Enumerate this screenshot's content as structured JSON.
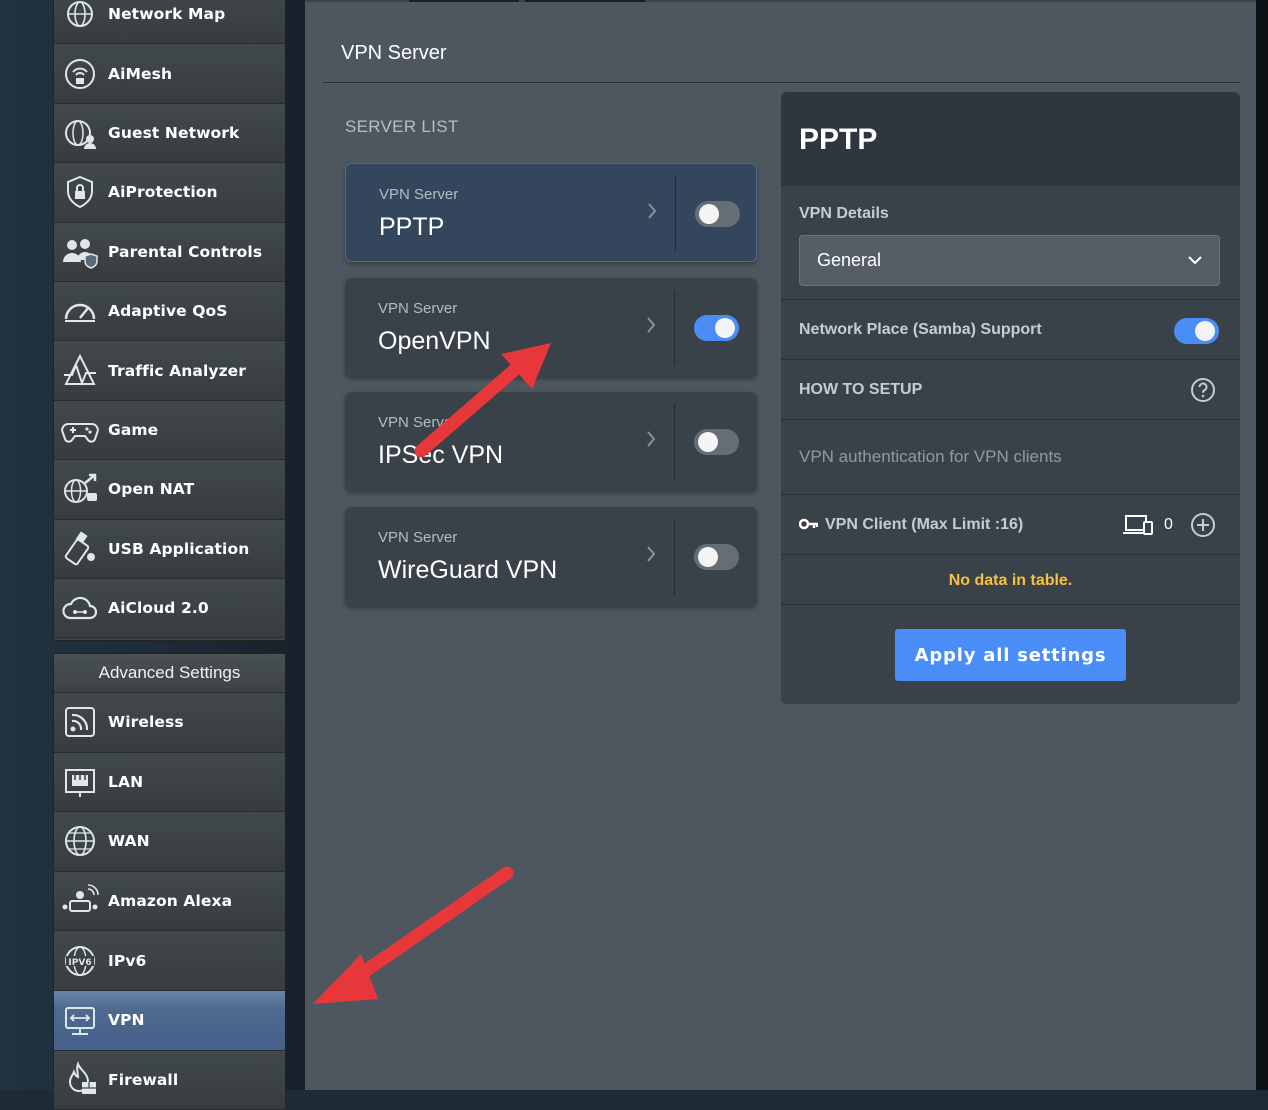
{
  "sidebar": {
    "general_items": [
      {
        "label": "Network Map",
        "icon": "network-map-icon"
      },
      {
        "label": "AiMesh",
        "icon": "aimesh-icon"
      },
      {
        "label": "Guest Network",
        "icon": "guest-network-icon"
      },
      {
        "label": "AiProtection",
        "icon": "aiprotection-icon"
      },
      {
        "label": "Parental Controls",
        "icon": "parental-controls-icon"
      },
      {
        "label": "Adaptive QoS",
        "icon": "adaptive-qos-icon"
      },
      {
        "label": "Traffic Analyzer",
        "icon": "traffic-analyzer-icon"
      },
      {
        "label": "Game",
        "icon": "game-icon"
      },
      {
        "label": "Open NAT",
        "icon": "open-nat-icon"
      },
      {
        "label": "USB Application",
        "icon": "usb-application-icon"
      },
      {
        "label": "AiCloud 2.0",
        "icon": "aicloud-icon"
      }
    ],
    "advanced_header": "Advanced Settings",
    "advanced_items": [
      {
        "label": "Wireless",
        "icon": "wireless-icon"
      },
      {
        "label": "LAN",
        "icon": "lan-icon"
      },
      {
        "label": "WAN",
        "icon": "wan-icon"
      },
      {
        "label": "Amazon Alexa",
        "icon": "alexa-icon"
      },
      {
        "label": "IPv6",
        "icon": "ipv6-icon"
      },
      {
        "label": "VPN",
        "icon": "vpn-icon",
        "active": true
      },
      {
        "label": "Firewall",
        "icon": "firewall-icon"
      }
    ]
  },
  "main": {
    "title": "VPN Server",
    "server_list_label": "SERVER LIST",
    "servers": [
      {
        "sub": "VPN Server",
        "name": "PPTP",
        "enabled": false,
        "selected": true
      },
      {
        "sub": "VPN Server",
        "name": "OpenVPN",
        "enabled": true,
        "selected": false
      },
      {
        "sub": "VPN Server",
        "name": "IPSec VPN",
        "enabled": false,
        "selected": false
      },
      {
        "sub": "VPN Server",
        "name": "WireGuard VPN",
        "enabled": false,
        "selected": false
      }
    ]
  },
  "detail": {
    "title": "PPTP",
    "vpn_details_label": "VPN Details",
    "vpn_details_value": "General",
    "samba_label": "Network Place (Samba) Support",
    "samba_enabled": true,
    "how_to_setup": "HOW TO SETUP",
    "auth_text": "VPN authentication for VPN clients",
    "client_label": "VPN Client (Max Limit :16)",
    "client_count": "0",
    "no_data": "No data in table.",
    "apply_button": "Apply all settings"
  },
  "colors": {
    "accent": "#4a8df6",
    "annotation_arrow": "#e8373a",
    "warning_text": "#f7c13f"
  }
}
